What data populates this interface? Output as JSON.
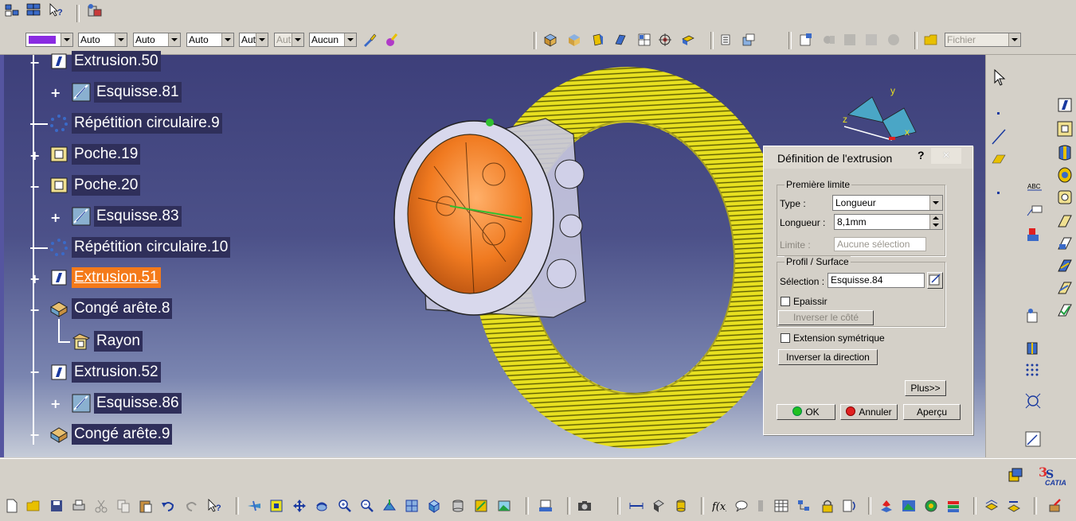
{
  "toolbar_top": {
    "color_combo": "",
    "combo1": "Auto",
    "combo2": "Auto",
    "combo3": "Auto",
    "combo4": "Aut",
    "combo5": "Aut",
    "combo6": "Aucun",
    "fichier": "Fichier",
    "accent_color": "#8a2be2"
  },
  "tree": {
    "nodes": [
      {
        "label": "Extrusion.50",
        "icon": "pad-icon"
      },
      {
        "label": "Esquisse.81",
        "icon": "sketch-icon"
      },
      {
        "label": "Répétition circulaire.9",
        "icon": "circular-pattern-icon"
      },
      {
        "label": "Poche.19",
        "icon": "pocket-icon"
      },
      {
        "label": "Poche.20",
        "icon": "pocket-icon"
      },
      {
        "label": "Esquisse.83",
        "icon": "sketch-icon"
      },
      {
        "label": "Répétition circulaire.10",
        "icon": "circular-pattern-icon"
      },
      {
        "label": "Extrusion.51",
        "icon": "pad-icon",
        "selected": true
      },
      {
        "label": "Congé arête.8",
        "icon": "fillet-icon"
      },
      {
        "label": "Rayon",
        "icon": "radius-icon"
      },
      {
        "label": "Extrusion.52",
        "icon": "pad-icon"
      },
      {
        "label": "Esquisse.86",
        "icon": "sketch-icon"
      },
      {
        "label": "Congé arête.9",
        "icon": "fillet-icon"
      }
    ]
  },
  "compass": {
    "x": "x",
    "y": "y",
    "z": "z"
  },
  "dialog": {
    "title": "Définition de l'extrusion",
    "help": "?",
    "close": "×",
    "first_limit": "Première limite",
    "type_label": "Type :",
    "type_value": "Longueur",
    "length_label": "Longueur :",
    "length_value": "8,1mm",
    "limit_label": "Limite :",
    "limit_value": "Aucune sélection",
    "profile_group": "Profil / Surface",
    "selection_label": "Sélection :",
    "selection_value": "Esquisse.84",
    "thicken": "Epaissir",
    "reverse_side": "Inverser le côté",
    "symmetric": "Extension symétrique",
    "reverse_dir": "Inverser la direction",
    "more": "Plus>>",
    "ok": "OK",
    "cancel": "Annuler",
    "preview": "Aperçu"
  },
  "catia_logo": "CATIA"
}
